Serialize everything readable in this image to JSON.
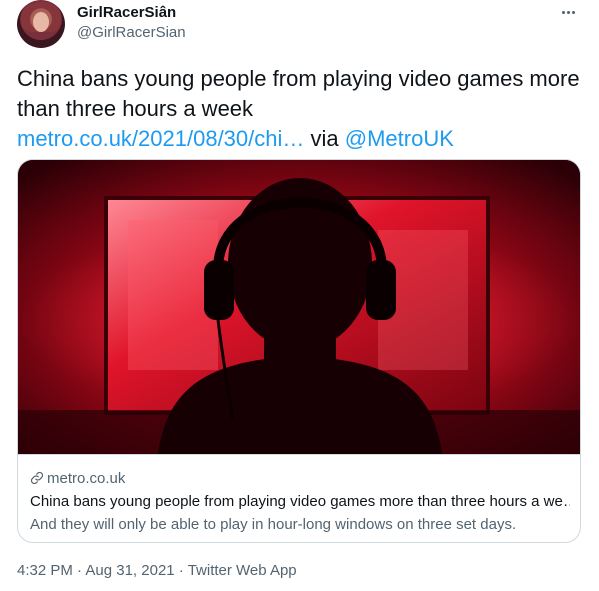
{
  "author": {
    "display_name": "GirlRacerSiân",
    "handle": "@GirlRacerSian",
    "avatar_icon": "profile-avatar"
  },
  "more_icon": "more-horizontal-icon",
  "tweet": {
    "text": "China bans young people from playing video games more than three hours a week",
    "link_text": "metro.co.uk/2021/08/30/chi…",
    "via_text": " via ",
    "mention": "@MetroUK"
  },
  "card": {
    "image_description_icon": "photo-silhouette-gamer",
    "domain": "metro.co.uk",
    "title": "China bans young people from playing video games more than three hours a we…",
    "description": "And they will only be able to play in hour-long windows on three set days."
  },
  "meta": {
    "time": "4:32 PM",
    "separator1": " · ",
    "date": "Aug 31, 2021",
    "separator2": " · ",
    "source": "Twitter Web App"
  },
  "colors": {
    "link": "#1d9bf0",
    "secondary_text": "#536471",
    "primary_text": "#0f1419",
    "border": "#cfd9de"
  }
}
